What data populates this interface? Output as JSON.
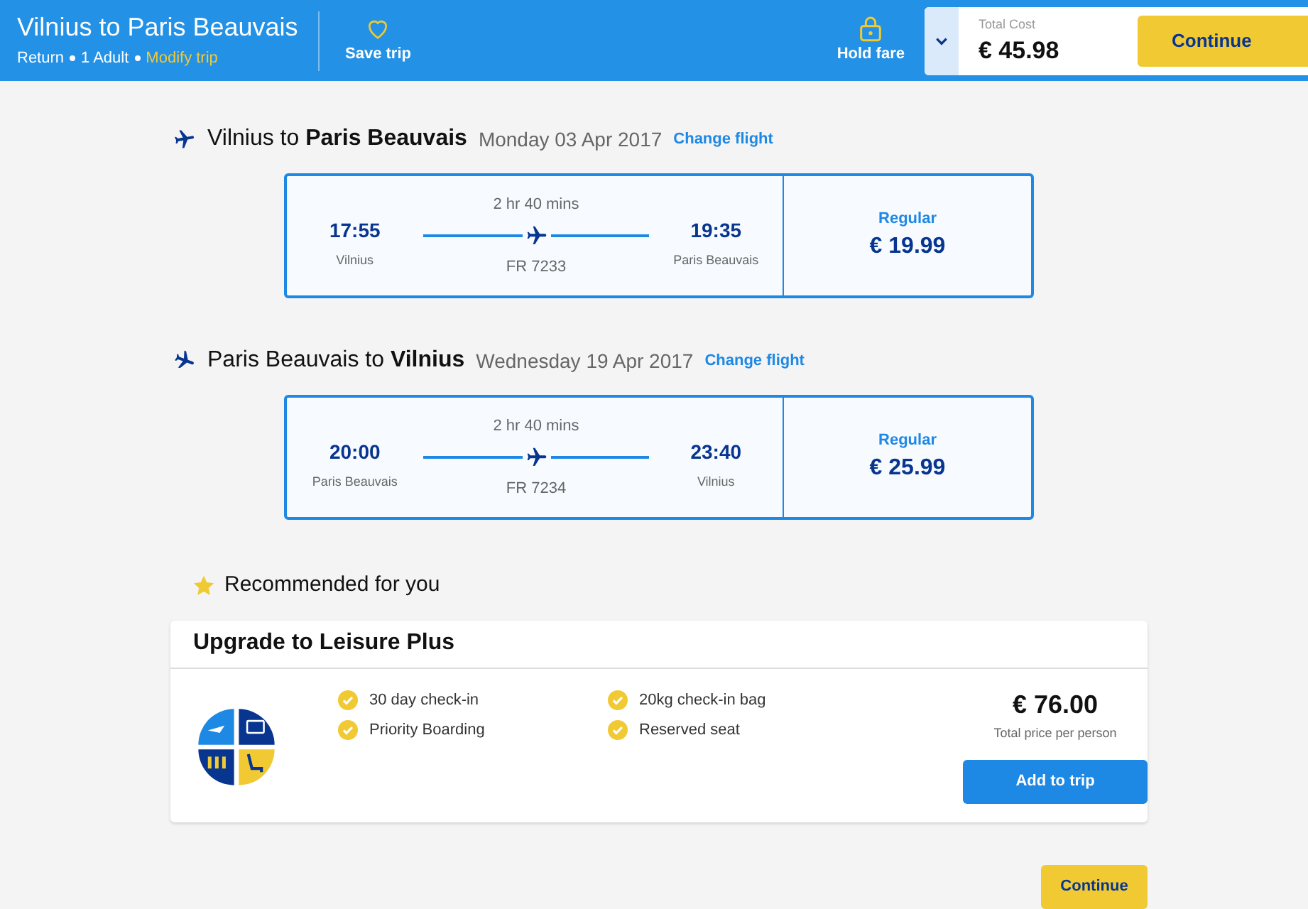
{
  "header": {
    "title": "Vilnius to Paris Beauvais",
    "trip_type": "Return",
    "passengers": "1 Adult",
    "modify_link": "Modify trip",
    "save_label": "Save trip",
    "hold_label": "Hold fare",
    "total_label": "Total Cost",
    "total": "€ 45.98",
    "continue_label": "Continue"
  },
  "flights": [
    {
      "kind": "outbound",
      "heading": "Vilnius to **Paris Beauvais**",
      "date": "Monday 03 Apr 2017",
      "change_link": "Change flight",
      "depart_time": "17:55",
      "depart_city": "Vilnius",
      "duration": "2 hr 40 mins",
      "flight_no": "FR 7233",
      "arrive_time": "19:35",
      "arrive_city": "Paris Beauvais",
      "fare_type": "Regular",
      "price": "€ 19.99"
    },
    {
      "kind": "inbound",
      "heading": "Paris Beauvais to **Vilnius**",
      "date": "Wednesday 19 Apr 2017",
      "change_link": "Change flight",
      "depart_time": "20:00",
      "depart_city": "Paris Beauvais",
      "duration": "2 hr 40 mins",
      "flight_no": "FR 7234",
      "arrive_time": "23:40",
      "arrive_city": "Vilnius",
      "fare_type": "Regular",
      "price": "€ 25.99"
    }
  ],
  "recommended": {
    "heading": "Recommended for you",
    "title": "Upgrade to Leisure Plus",
    "features": [
      "30 day check-in",
      "Priority Boarding",
      "20kg check-in bag",
      "Reserved seat"
    ],
    "price": "€ 76.00",
    "price_note": "Total price per person",
    "button": "Add to trip"
  },
  "footer": {
    "continue_label": "Continue"
  }
}
